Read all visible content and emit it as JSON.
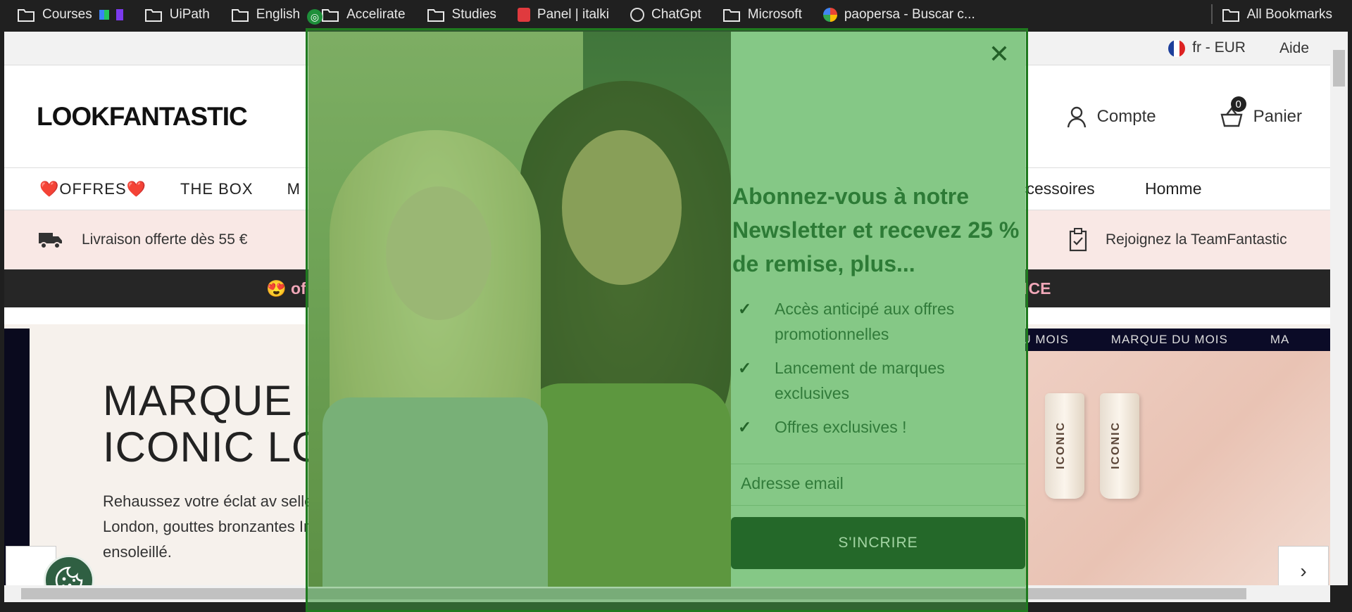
{
  "bookmarks": {
    "items": [
      {
        "label": "Courses",
        "icon": "folder-icon"
      },
      {
        "label": "UiPath",
        "icon": "folder-icon"
      },
      {
        "label": "English",
        "icon": "folder-icon"
      },
      {
        "label": "Accelirate",
        "icon": "folder-icon"
      },
      {
        "label": "Studies",
        "icon": "folder-icon"
      },
      {
        "label": "Panel | italki",
        "icon": "italki-icon"
      },
      {
        "label": "ChatGpt",
        "icon": "chatgpt-icon"
      },
      {
        "label": "Microsoft",
        "icon": "folder-icon"
      },
      {
        "label": "paopersa - Buscar c...",
        "icon": "google-icon"
      }
    ],
    "all_bookmarks": "All Bookmarks"
  },
  "topbar": {
    "locale": "fr - EUR",
    "help": "Aide"
  },
  "header": {
    "logo": "LOOKFANTASTIC",
    "account": "Compte",
    "cart": "Panier",
    "cart_count": "0"
  },
  "nav": {
    "offers": "❤️OFFRES❤️",
    "the_box": "THE BOX",
    "partial": "M",
    "accessories": "ccessoires",
    "men": "Homme"
  },
  "promo": {
    "delivery": "Livraison offerte dès 55 €",
    "join": "Rejoignez la TeamFantastic"
  },
  "dark_banner": {
    "left": "😍 of",
    "right": "ONCE"
  },
  "hero": {
    "title_line1": "MARQUE D",
    "title_line2": "ICONIC LO",
    "body": "Rehaussez votre éclat av sellers d'ICONIC London, gouttes bronzantes Insta teint ensoleillé.",
    "ticker": [
      "E DU MOIS",
      "MARQUE DU MOIS",
      "MA"
    ],
    "product_label": "ICONIC"
  },
  "modal": {
    "heading": "Abonnez-vous à notre Newsletter et recevez 25 % de remise, plus...",
    "benefits": [
      "Accès anticipé aux offres promotionnelles",
      "Lancement de marques exclusives",
      "Offres exclusives !"
    ],
    "email_placeholder": "Adresse email",
    "submit_label": "S'INCRIRE"
  },
  "colors": {
    "overlay": "#4caf50",
    "submit_bg": "#0d3a16",
    "form_bg": "#b3deb5",
    "heading": "#1c5a2c"
  }
}
